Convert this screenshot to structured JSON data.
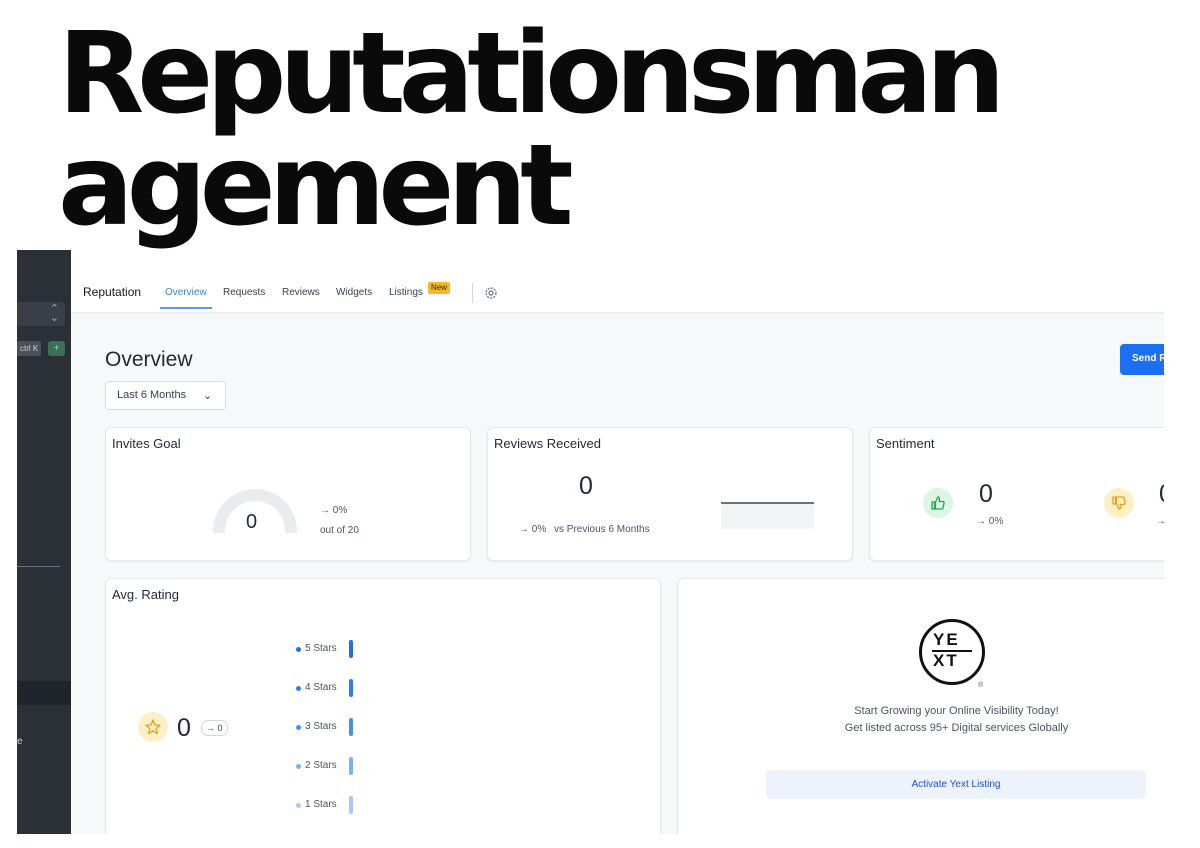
{
  "headline": "Reputationsmanagement",
  "sidebar": {
    "shortcut": "ctrl K",
    "plus_icon": "+",
    "partial_label": "e"
  },
  "topbar": {
    "brand": "Reputation",
    "tabs": [
      {
        "label": "Overview"
      },
      {
        "label": "Requests"
      },
      {
        "label": "Reviews"
      },
      {
        "label": "Widgets"
      },
      {
        "label": "Listings"
      }
    ],
    "listings_badge": "New",
    "icons": [
      "settings-gear-icon",
      "phone-icon"
    ]
  },
  "page": {
    "title": "Overview",
    "range": "Last 6 Months",
    "send_button": "Send R"
  },
  "invites_goal": {
    "title": "Invites Goal",
    "value": "0",
    "progress_fraction": 0,
    "trend": "→ 0%",
    "goal_text": "out of 20"
  },
  "reviews_received": {
    "title": "Reviews Received",
    "value": "0",
    "trend": "→ 0%",
    "comparison": "vs Previous 6 Months"
  },
  "sentiment": {
    "title": "Sentiment",
    "positive_value": "0",
    "positive_trend": "→ 0%",
    "negative_value": "0",
    "negative_trend": "→"
  },
  "avg_rating": {
    "title": "Avg. Rating",
    "value": "0",
    "trend": "→ 0",
    "stars": [
      {
        "label": "5 Stars",
        "color": "#1d6ff2"
      },
      {
        "label": "4 Stars",
        "color": "#2f7bf0"
      },
      {
        "label": "3 Stars",
        "color": "#4b8ef2"
      },
      {
        "label": "2 Stars",
        "color": "#7eaef5"
      },
      {
        "label": "1 Stars",
        "color": "#a9c8f7"
      }
    ]
  },
  "yext": {
    "logo_top": "YE",
    "logo_bottom": "XT",
    "registered": "®",
    "line1": "Start Growing your Online Visibility Today!",
    "line2": "Get listed across 95+ Digital services Globally",
    "button": "Activate Yext Listing"
  },
  "colors": {
    "accent": "#1d6ff2",
    "positive": "#22a84f",
    "warning": "#f2b92c",
    "sidebar": "#2b2f36"
  }
}
